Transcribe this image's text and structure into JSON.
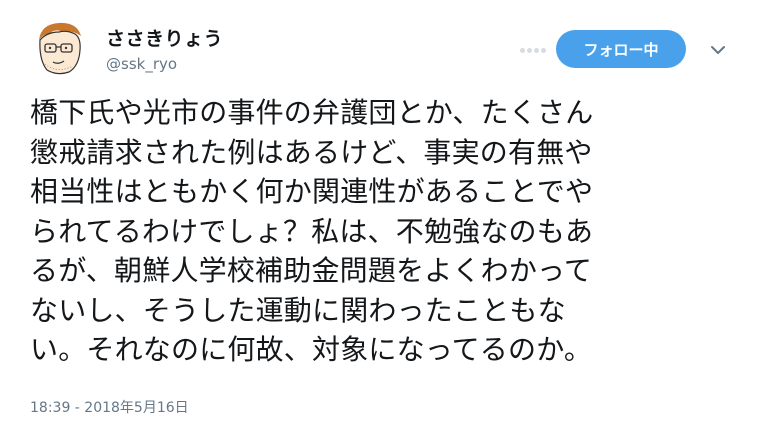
{
  "user": {
    "display_name": "ささきりょう",
    "handle": "@ssk_ryo"
  },
  "follow_button": {
    "label": "フォロー中",
    "color": "#4aa1eb"
  },
  "menu": {
    "icon": "chevron-down-icon"
  },
  "tweet": {
    "lines": [
      "橋下氏や光市の事件の弁護団とか、たくさん",
      "懲戒請求された例はあるけど、事実の有無や",
      "相当性はともかく何か関連性があることでや",
      "られてるわけでしょ？私は、不勉強なのもあ",
      "るが、朝鮮人学校補助金問題をよくわかって",
      "ないし、そうした運動に関わったこともな",
      "い。それなのに何故、対象になってるのか。"
    ],
    "timestamp": "18:39 - 2018年5月16日"
  }
}
